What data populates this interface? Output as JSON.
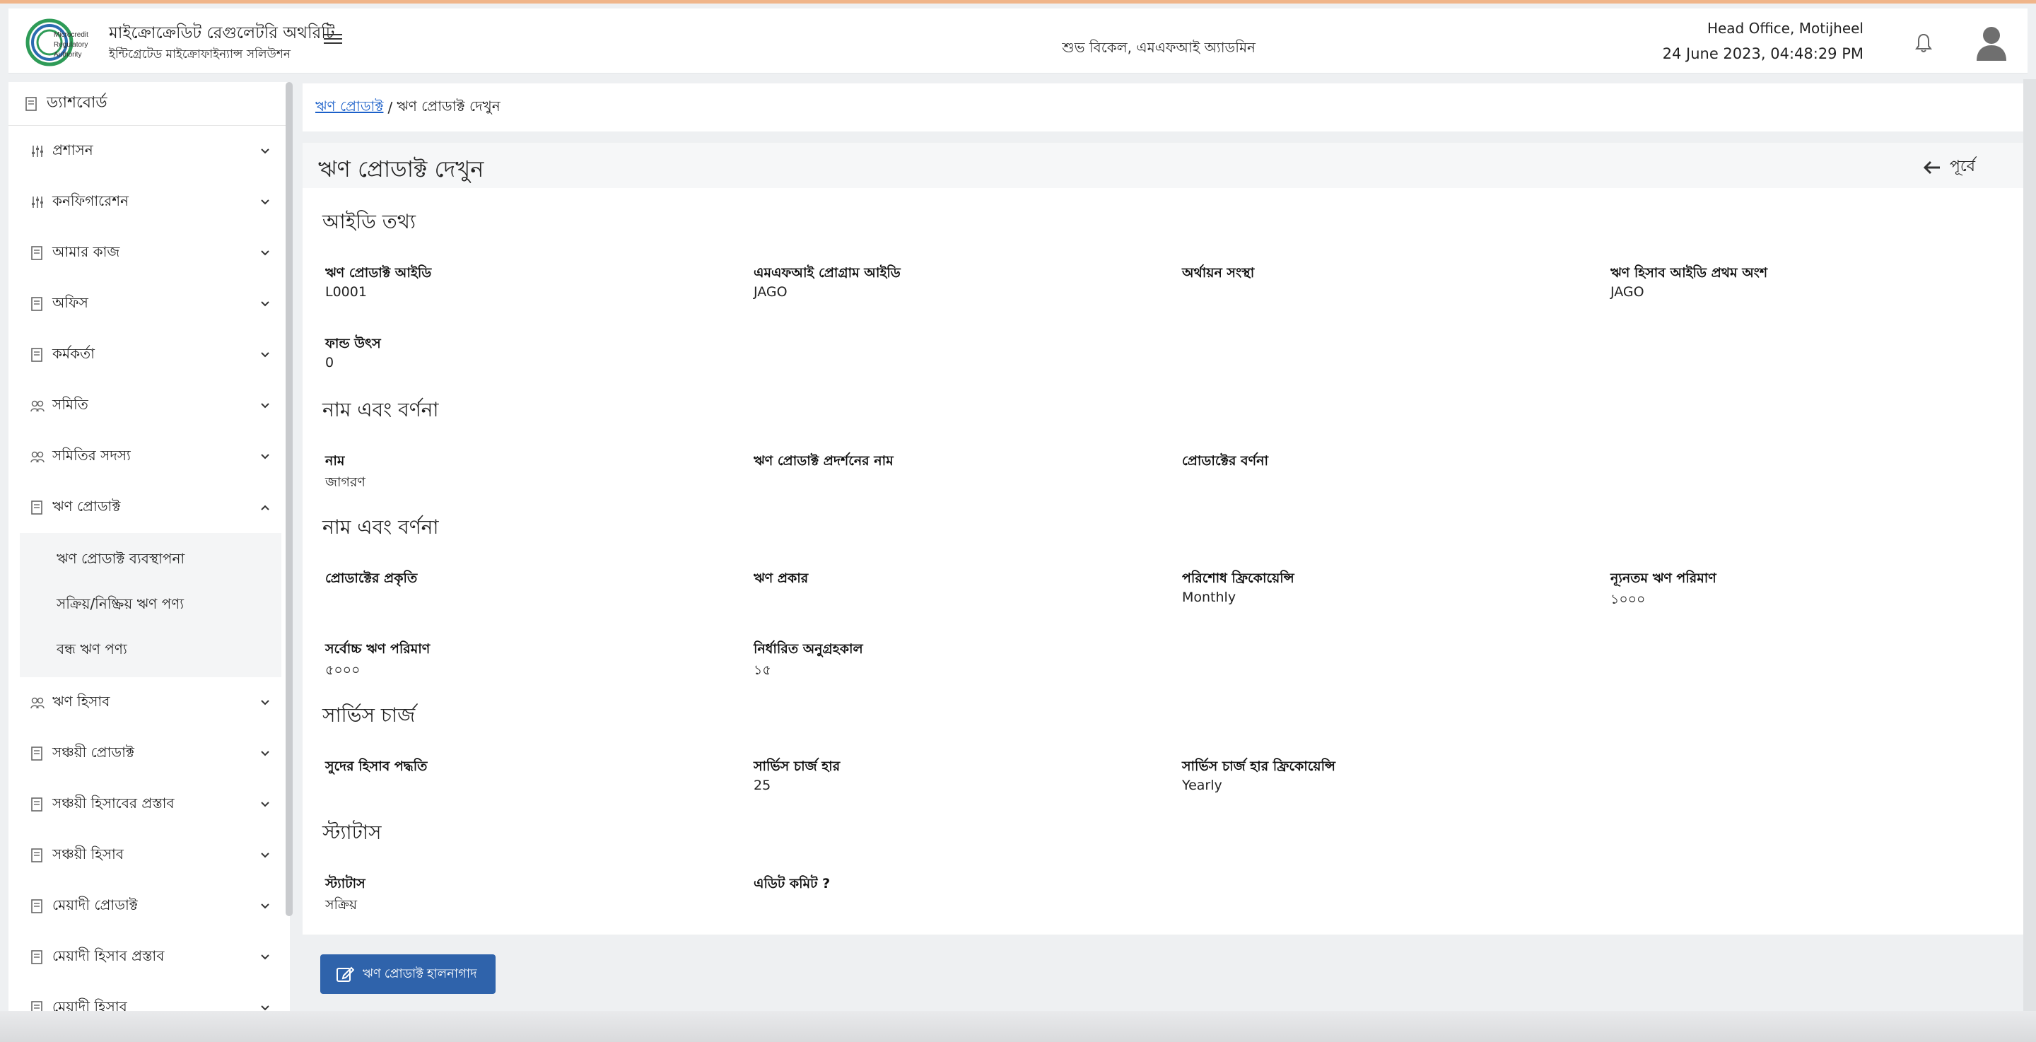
{
  "header": {
    "org_title": "মাইক্রোক্রেডিট রেগুলেটরি অথরিটি",
    "org_subtitle": "ইন্টিগ্রেটেড মাইক্রোফাইন্যান্স সলিউশন",
    "logo_text": [
      "Microcredit",
      "Regulatory",
      "Authority"
    ],
    "greeting": "শুভ বিকেল, এমএফআই অ্যাডমিন",
    "office": "Head Office, Motijheel",
    "datetime": "24 June 2023, 04:48:29 PM"
  },
  "sidebar": {
    "dashboard": "ড্যাশবোর্ড",
    "items": [
      {
        "label": "প্রশাসন",
        "icon": "sliders-icon"
      },
      {
        "label": "কনফিগারেশন",
        "icon": "sliders-icon"
      },
      {
        "label": "আমার কাজ",
        "icon": "document-icon"
      },
      {
        "label": "অফিস",
        "icon": "document-icon"
      },
      {
        "label": "কর্মকর্তা",
        "icon": "document-icon"
      },
      {
        "label": "সমিতি",
        "icon": "people-icon"
      },
      {
        "label": "সমিতির সদস্য",
        "icon": "people-icon"
      },
      {
        "label": "ঋণ প্রোডাক্ট",
        "icon": "document-icon",
        "expanded": true
      },
      {
        "label": "ঋণ হিসাব",
        "icon": "people-icon"
      },
      {
        "label": "সঞ্চয়ী প্রোডাক্ট",
        "icon": "document-icon"
      },
      {
        "label": "সঞ্চয়ী হিসাবের প্রস্তাব",
        "icon": "document-icon"
      },
      {
        "label": "সঞ্চয়ী হিসাব",
        "icon": "document-icon"
      },
      {
        "label": "মেয়াদী প্রোডাক্ট",
        "icon": "document-icon"
      },
      {
        "label": "মেয়াদী হিসাব প্রস্তাব",
        "icon": "document-icon"
      },
      {
        "label": "মেয়াদী হিসাব",
        "icon": "document-icon"
      }
    ],
    "submenu": [
      "ঋণ প্রোডাক্ট ব্যবস্থাপনা",
      "সক্রিয়/নিষ্ক্রিয় ঋণ পণ্য",
      "বন্ধ ঋণ পণ্য"
    ]
  },
  "breadcrumb": {
    "link": "ঋণ প্রোডাক্ট",
    "separator": "/",
    "current": "ঋণ প্রোডাক্ট দেখুন"
  },
  "page": {
    "title": "ঋণ প্রোডাক্ট দেখুন",
    "back_label": "পূর্বে"
  },
  "sections": {
    "id_info": {
      "title": "আইডি তথ্য",
      "fields": [
        {
          "label": "ঋণ প্রোডাক্ট আইডি",
          "value": "L0001"
        },
        {
          "label": "এমএফআই প্রোগ্রাম আইডি",
          "value": "JAGO"
        },
        {
          "label": "অর্থায়ন সংস্থা",
          "value": ""
        },
        {
          "label": "ঋণ হিসাব আইডি প্রথম অংশ",
          "value": "JAGO"
        },
        {
          "label": "ফান্ড উৎস",
          "value": "0"
        }
      ]
    },
    "name_desc": {
      "title": "নাম এবং বর্ণনা",
      "fields": [
        {
          "label": "নাম",
          "value": "জাগরণ"
        },
        {
          "label": "ঋণ প্রোডাক্ট প্রদর্শনের নাম",
          "value": ""
        },
        {
          "label": "প্রোডাক্টের বর্ণনা",
          "value": ""
        }
      ]
    },
    "name_desc2": {
      "title": "নাম এবং বর্ণনা",
      "fields": [
        {
          "label": "প্রোডাক্টের প্রকৃতি",
          "value": ""
        },
        {
          "label": "ঋণ প্রকার",
          "value": ""
        },
        {
          "label": "পরিশোধ ফ্রিকোয়েন্সি",
          "value": "Monthly"
        },
        {
          "label": "ন্যূনতম ঋণ পরিমাণ",
          "value": "১০০০"
        },
        {
          "label": "সর্বোচ্চ ঋণ পরিমাণ",
          "value": "৫০০০"
        },
        {
          "label": "নির্ধারিত অনুগ্রহকাল",
          "value": "১৫"
        }
      ]
    },
    "service_charge": {
      "title": "সার্ভিস চার্জ",
      "fields": [
        {
          "label": "সুদের হিসাব পদ্ধতি",
          "value": ""
        },
        {
          "label": "সার্ভিস চার্জ হার",
          "value": "25"
        },
        {
          "label": "সার্ভিস চার্জ হার ফ্রিকোয়েন্সি",
          "value": "Yearly"
        }
      ]
    },
    "status": {
      "title": "স্ট্যাটাস",
      "fields": [
        {
          "label": "স্ট্যাটাস",
          "value": "সক্রিয়"
        },
        {
          "label": "এডিট কমিট ?",
          "value": ""
        }
      ]
    }
  },
  "edit_button_label": "ঋণ প্রোডাক্ট হালনাগাদ",
  "colors": {
    "primary_button": "#2f63ab",
    "link": "#1a5fc9",
    "logo_green": "#2e9b57",
    "logo_blue": "#2b6bb0"
  }
}
